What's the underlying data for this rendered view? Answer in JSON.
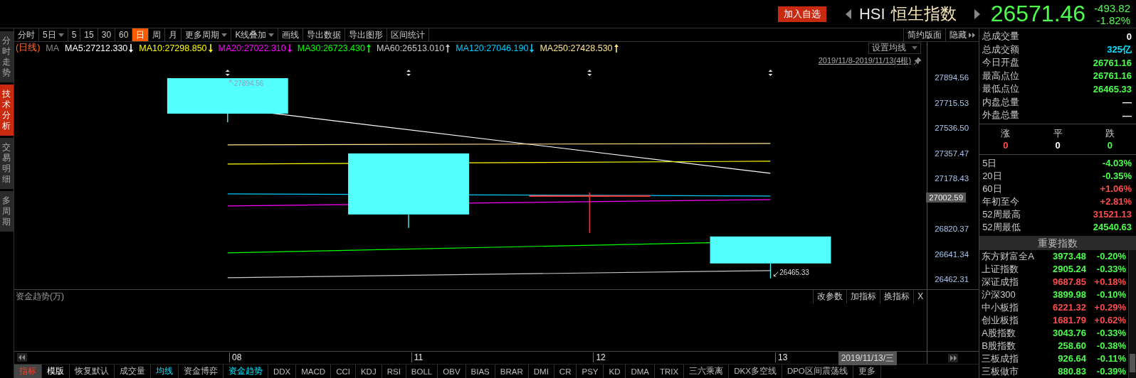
{
  "header": {
    "add_button": "加入自选",
    "symbol": "HSI",
    "name": "恒生指数",
    "price": "26571.46",
    "change": "-493.82",
    "change_pct": "-1.82%",
    "rising": false
  },
  "side_tabs": [
    {
      "label": "分时走势",
      "selected": false
    },
    {
      "label": "技术分析",
      "selected": true
    },
    {
      "label": "交易明细",
      "selected": false
    },
    {
      "label": "多周期",
      "selected": false
    }
  ],
  "toolbar": {
    "items": [
      {
        "label": "分时",
        "selected": false,
        "dropdown": false
      },
      {
        "label": "5日",
        "selected": false,
        "dropdown": true
      },
      {
        "label": "5",
        "selected": false,
        "dropdown": false
      },
      {
        "label": "15",
        "selected": false,
        "dropdown": false
      },
      {
        "label": "30",
        "selected": false,
        "dropdown": false
      },
      {
        "label": "60",
        "selected": false,
        "dropdown": false
      },
      {
        "label": "日",
        "selected": true,
        "dropdown": false
      },
      {
        "label": "周",
        "selected": false,
        "dropdown": false
      },
      {
        "label": "月",
        "selected": false,
        "dropdown": false
      },
      {
        "label": "更多周期",
        "selected": false,
        "dropdown": true
      },
      {
        "label": "K线叠加",
        "selected": false,
        "dropdown": true
      },
      {
        "label": "画线",
        "selected": false,
        "dropdown": false
      },
      {
        "label": "导出数据",
        "selected": false,
        "dropdown": false
      },
      {
        "label": "导出图形",
        "selected": false,
        "dropdown": false
      },
      {
        "label": "区间统计",
        "selected": false,
        "dropdown": false
      }
    ],
    "right": [
      "简约版面",
      "隐藏"
    ]
  },
  "ma_legend": {
    "period": "(日线)",
    "title": "MA",
    "items": [
      {
        "label": "MA5:27212.330",
        "color": "#ffffff",
        "rising": false
      },
      {
        "label": "MA10:27298.850",
        "color": "#ffff00",
        "rising": false
      },
      {
        "label": "MA20:27022.310",
        "color": "#ff00ff",
        "rising": false
      },
      {
        "label": "MA30:26723.430",
        "color": "#00ff00",
        "rising": true
      },
      {
        "label": "MA60:26513.010",
        "color": "#c8c8c8",
        "rising": true
      },
      {
        "label": "MA120:27046.190",
        "color": "#00ccff",
        "rising": false
      },
      {
        "label": "MA250:27428.530",
        "color": "#ffe68c",
        "rising": true
      }
    ],
    "settings_button": "设置均线"
  },
  "chart": {
    "range": "2019/11/8-2019/11/13(4根)",
    "high_label": "27894.56",
    "low_label": "26465.33",
    "price_tag": "27002.59",
    "y_labels": [
      "27894.56",
      "27715.53",
      "27536.50",
      "27357.47",
      "27178.43",
      "26820.37",
      "26641.34",
      "26462.31"
    ],
    "candles": [
      {
        "kind": "fall"
      },
      {
        "kind": "fall"
      },
      {
        "kind": "rise"
      },
      {
        "kind": "fall"
      }
    ]
  },
  "lower_pane": {
    "title": "资金趋势(万)",
    "buttons": [
      "改参数",
      "加指标",
      "换指标"
    ],
    "close": "X"
  },
  "x_axis": {
    "labels": [
      "08",
      "11",
      "12",
      "13"
    ],
    "cursor_date": "2019/11/13/三"
  },
  "bottom_tabs": [
    {
      "label": "指标",
      "selected": true,
      "kind": "tab",
      "on": false
    },
    {
      "label": "模版",
      "selected": false,
      "kind": "menu",
      "on": false
    },
    {
      "label": "恢复默认",
      "selected": false,
      "kind": "indicator",
      "on": false
    },
    {
      "label": "成交量",
      "selected": false,
      "kind": "indicator",
      "on": false
    },
    {
      "label": "均线",
      "selected": false,
      "kind": "indicator",
      "on": true
    },
    {
      "label": "资金博弈",
      "selected": false,
      "kind": "indicator",
      "on": false
    },
    {
      "label": "资金趋势",
      "selected": false,
      "kind": "indicator",
      "on": true
    },
    {
      "label": "DDX",
      "selected": false,
      "kind": "indicator",
      "on": false
    },
    {
      "label": "MACD",
      "selected": false,
      "kind": "indicator",
      "on": false
    },
    {
      "label": "CCI",
      "selected": false,
      "kind": "indicator",
      "on": false
    },
    {
      "label": "KDJ",
      "selected": false,
      "kind": "indicator",
      "on": false
    },
    {
      "label": "RSI",
      "selected": false,
      "kind": "indicator",
      "on": false
    },
    {
      "label": "BOLL",
      "selected": false,
      "kind": "indicator",
      "on": false
    },
    {
      "label": "OBV",
      "selected": false,
      "kind": "indicator",
      "on": false
    },
    {
      "label": "BIAS",
      "selected": false,
      "kind": "indicator",
      "on": false
    },
    {
      "label": "BRAR",
      "selected": false,
      "kind": "indicator",
      "on": false
    },
    {
      "label": "DMI",
      "selected": false,
      "kind": "indicator",
      "on": false
    },
    {
      "label": "CR",
      "selected": false,
      "kind": "indicator",
      "on": false
    },
    {
      "label": "PSY",
      "selected": false,
      "kind": "indicator",
      "on": false
    },
    {
      "label": "KD",
      "selected": false,
      "kind": "indicator",
      "on": false
    },
    {
      "label": "DMA",
      "selected": false,
      "kind": "indicator",
      "on": false
    },
    {
      "label": "TRIX",
      "selected": false,
      "kind": "indicator",
      "on": false
    },
    {
      "label": "三六乘离",
      "selected": false,
      "kind": "indicator",
      "on": false
    },
    {
      "label": "DKX多空线",
      "selected": false,
      "kind": "indicator",
      "on": false
    },
    {
      "label": "DPO区间震荡线",
      "selected": false,
      "kind": "indicator",
      "on": false
    },
    {
      "label": "更多",
      "selected": false,
      "kind": "indicator",
      "on": false
    }
  ],
  "stats": [
    {
      "label": "总成交量",
      "value": "0",
      "color": "#ffffff"
    },
    {
      "label": "总成交额",
      "value": "325亿",
      "color": "#00e5ff"
    },
    {
      "label": "今日开盘",
      "value": "26761.16",
      "color": "#4cff4c"
    },
    {
      "label": "最高点位",
      "value": "26761.16",
      "color": "#4cff4c"
    },
    {
      "label": "最低点位",
      "value": "26465.33",
      "color": "#4cff4c"
    },
    {
      "label": "内盘总量",
      "value": "—",
      "color": "#ffffff"
    },
    {
      "label": "外盘总量",
      "value": "—",
      "color": "#ffffff"
    }
  ],
  "breadth": [
    {
      "label": "涨",
      "value": "0",
      "color": "#ff4c4c"
    },
    {
      "label": "平",
      "value": "0",
      "color": "#ffffff"
    },
    {
      "label": "跌",
      "value": "0",
      "color": "#4cff4c"
    }
  ],
  "returns": [
    {
      "label": "5日",
      "value": "-4.03%",
      "color": "#4cff4c"
    },
    {
      "label": "20日",
      "value": "-0.35%",
      "color": "#4cff4c"
    },
    {
      "label": "60日",
      "value": "+1.06%",
      "color": "#ff4c4c"
    },
    {
      "label": "年初至今",
      "value": "+2.81%",
      "color": "#ff4c4c"
    },
    {
      "label": "52周最高",
      "value": "31521.13",
      "color": "#ff4c4c"
    },
    {
      "label": "52周最低",
      "value": "24540.63",
      "color": "#4cff4c"
    }
  ],
  "indices": {
    "title": "重要指数",
    "rows": [
      {
        "name": "东方财富全A",
        "price": "3973.48",
        "change": "-0.20%",
        "color": "#4cff4c"
      },
      {
        "name": "上证指数",
        "price": "2905.24",
        "change": "-0.33%",
        "color": "#4cff4c"
      },
      {
        "name": "深证成指",
        "price": "9687.85",
        "change": "+0.18%",
        "color": "#ff4c4c"
      },
      {
        "name": "沪深300",
        "price": "3899.98",
        "change": "-0.10%",
        "color": "#4cff4c"
      },
      {
        "name": "中小板指",
        "price": "6221.32",
        "change": "+0.29%",
        "color": "#ff4c4c"
      },
      {
        "name": "创业板指",
        "price": "1681.79",
        "change": "+0.62%",
        "color": "#ff4c4c"
      },
      {
        "name": "A股指数",
        "price": "3043.76",
        "change": "-0.33%",
        "color": "#4cff4c"
      },
      {
        "name": "B股指数",
        "price": "258.60",
        "change": "-0.38%",
        "color": "#4cff4c"
      },
      {
        "name": "三板成指",
        "price": "926.64",
        "change": "-0.11%",
        "color": "#4cff4c"
      },
      {
        "name": "三板做市",
        "price": "880.83",
        "change": "-0.39%",
        "color": "#4cff4c"
      }
    ]
  }
}
